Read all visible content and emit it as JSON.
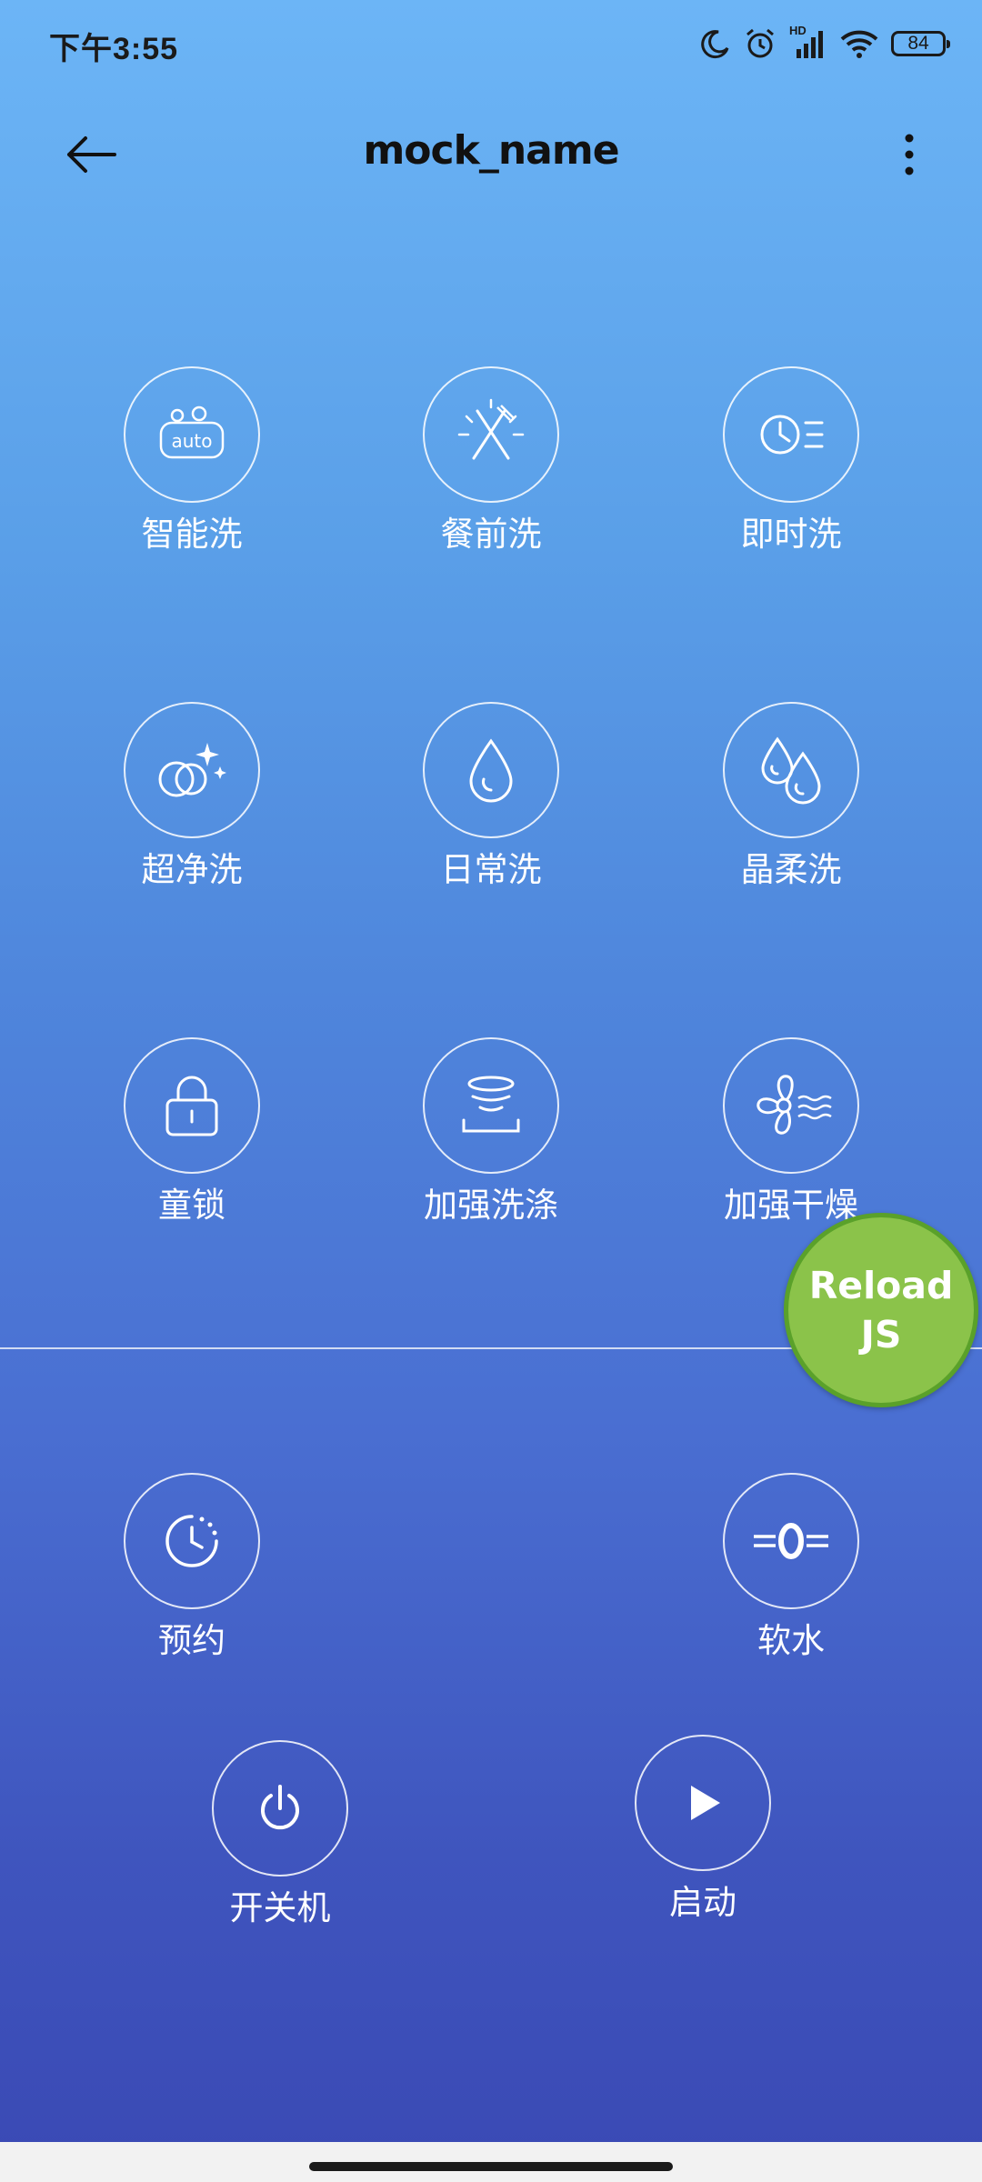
{
  "status_bar": {
    "time": "下午3:55",
    "battery": "84",
    "network_label": "HD"
  },
  "header": {
    "title": "mock_name"
  },
  "modes": [
    {
      "label": "智能洗",
      "icon": "auto-wash-icon"
    },
    {
      "label": "餐前洗",
      "icon": "cutlery-icon"
    },
    {
      "label": "即时洗",
      "icon": "quick-clock-icon"
    },
    {
      "label": "超净洗",
      "icon": "sparkle-dishes-icon"
    },
    {
      "label": "日常洗",
      "icon": "water-drop-icon"
    },
    {
      "label": "晶柔洗",
      "icon": "double-drop-icon"
    },
    {
      "label": "童锁",
      "icon": "lock-icon"
    },
    {
      "label": "加强洗涤",
      "icon": "spray-bowl-icon"
    },
    {
      "label": "加强干燥",
      "icon": "fan-dry-icon"
    }
  ],
  "functions": [
    {
      "label": "预约",
      "icon": "timer-icon"
    },
    {
      "label": "软水",
      "icon": "soft-water-icon"
    }
  ],
  "controls": [
    {
      "label": "开关机",
      "icon": "power-icon"
    },
    {
      "label": "启动",
      "icon": "play-icon"
    }
  ],
  "reload": {
    "line1": "Reload",
    "line2": "JS"
  }
}
